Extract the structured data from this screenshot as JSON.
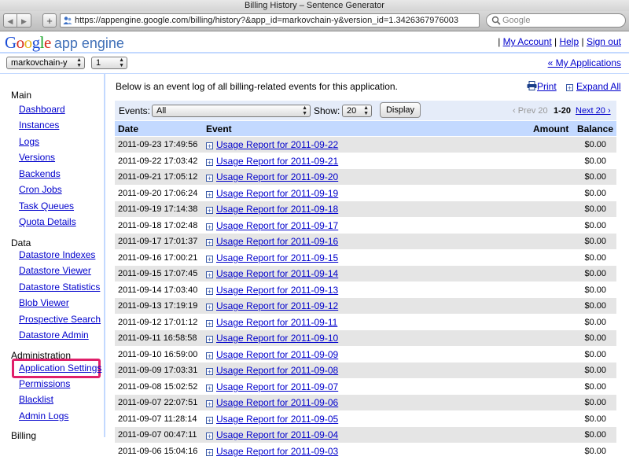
{
  "window": {
    "title": "Billing History – Sentence Generator"
  },
  "browser": {
    "url": "https://appengine.google.com/billing/history?&app_id=markovchain-y&version_id=1.3426367976003",
    "search_placeholder": "Google"
  },
  "header": {
    "logo_parts": [
      "G",
      "o",
      "o",
      "g",
      "l",
      "e"
    ],
    "product": "app engine",
    "links": [
      "My Account",
      "Help",
      "Sign out"
    ],
    "my_applications": "« My Applications",
    "app_select": "markovchain-y",
    "version_select": "1"
  },
  "sidebar": {
    "sections": [
      {
        "title": "Main",
        "items": [
          "Dashboard",
          "Instances",
          "Logs",
          "Versions",
          "Backends",
          "Cron Jobs",
          "Task Queues",
          "Quota Details"
        ]
      },
      {
        "title": "Data",
        "items": [
          "Datastore Indexes",
          "Datastore Viewer",
          "Datastore Statistics",
          "Blob Viewer",
          "Prospective Search",
          "Datastore Admin"
        ]
      },
      {
        "title": "Administration",
        "items": [
          "Application Settings",
          "Permissions",
          "Blacklist",
          "Admin Logs"
        ]
      },
      {
        "title": "Billing",
        "items": []
      }
    ],
    "highlight_color": "#e0206a"
  },
  "main": {
    "intro": "Below is an event log of all billing-related events for this application.",
    "print_label": "Print",
    "expand_label": "Expand All",
    "events_label": "Events:",
    "events_value": "All",
    "show_label": "Show:",
    "show_value": "20",
    "display_button": "Display",
    "prev_label": "‹ Prev 20",
    "range_label": "1-20",
    "next_label": "Next 20 ›",
    "columns": {
      "date": "Date",
      "event": "Event",
      "amount": "Amount",
      "balance": "Balance"
    },
    "rows": [
      {
        "date": "2011-09-23 17:49:56",
        "event": "Usage Report for 2011-09-22",
        "amount": "",
        "balance": "$0.00"
      },
      {
        "date": "2011-09-22 17:03:42",
        "event": "Usage Report for 2011-09-21",
        "amount": "",
        "balance": "$0.00"
      },
      {
        "date": "2011-09-21 17:05:12",
        "event": "Usage Report for 2011-09-20",
        "amount": "",
        "balance": "$0.00"
      },
      {
        "date": "2011-09-20 17:06:24",
        "event": "Usage Report for 2011-09-19",
        "amount": "",
        "balance": "$0.00"
      },
      {
        "date": "2011-09-19 17:14:38",
        "event": "Usage Report for 2011-09-18",
        "amount": "",
        "balance": "$0.00"
      },
      {
        "date": "2011-09-18 17:02:48",
        "event": "Usage Report for 2011-09-17",
        "amount": "",
        "balance": "$0.00"
      },
      {
        "date": "2011-09-17 17:01:37",
        "event": "Usage Report for 2011-09-16",
        "amount": "",
        "balance": "$0.00"
      },
      {
        "date": "2011-09-16 17:00:21",
        "event": "Usage Report for 2011-09-15",
        "amount": "",
        "balance": "$0.00"
      },
      {
        "date": "2011-09-15 17:07:45",
        "event": "Usage Report for 2011-09-14",
        "amount": "",
        "balance": "$0.00"
      },
      {
        "date": "2011-09-14 17:03:40",
        "event": "Usage Report for 2011-09-13",
        "amount": "",
        "balance": "$0.00"
      },
      {
        "date": "2011-09-13 17:19:19",
        "event": "Usage Report for 2011-09-12",
        "amount": "",
        "balance": "$0.00"
      },
      {
        "date": "2011-09-12 17:01:12",
        "event": "Usage Report for 2011-09-11",
        "amount": "",
        "balance": "$0.00"
      },
      {
        "date": "2011-09-11 16:58:58",
        "event": "Usage Report for 2011-09-10",
        "amount": "",
        "balance": "$0.00"
      },
      {
        "date": "2011-09-10 16:59:00",
        "event": "Usage Report for 2011-09-09",
        "amount": "",
        "balance": "$0.00"
      },
      {
        "date": "2011-09-09 17:03:31",
        "event": "Usage Report for 2011-09-08",
        "amount": "",
        "balance": "$0.00"
      },
      {
        "date": "2011-09-08 15:02:52",
        "event": "Usage Report for 2011-09-07",
        "amount": "",
        "balance": "$0.00"
      },
      {
        "date": "2011-09-07 22:07:51",
        "event": "Usage Report for 2011-09-06",
        "amount": "",
        "balance": "$0.00"
      },
      {
        "date": "2011-09-07 11:28:14",
        "event": "Usage Report for 2011-09-05",
        "amount": "",
        "balance": "$0.00"
      },
      {
        "date": "2011-09-07 00:47:11",
        "event": "Usage Report for 2011-09-04",
        "amount": "",
        "balance": "$0.00"
      },
      {
        "date": "2011-09-06 15:04:16",
        "event": "Usage Report for 2011-09-03",
        "amount": "",
        "balance": "$0.00"
      }
    ]
  }
}
